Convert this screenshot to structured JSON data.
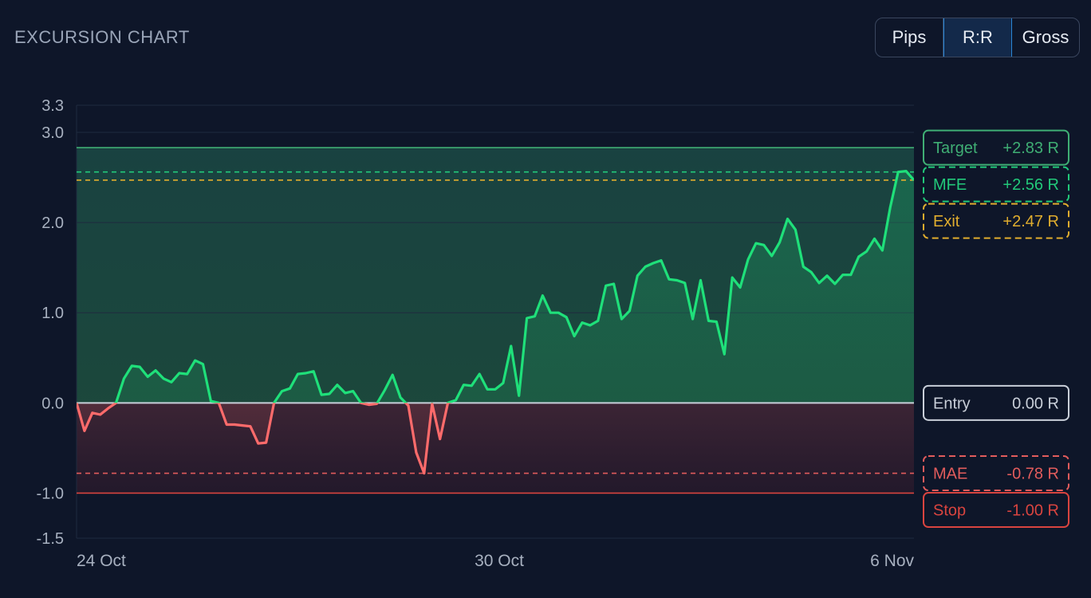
{
  "header": {
    "title": "EXCURSION CHART",
    "toggle": {
      "options": [
        "Pips",
        "R:R",
        "Gross"
      ],
      "selected": "R:R"
    }
  },
  "chart_data": {
    "type": "line",
    "title": "EXCURSION CHART",
    "ylim": [
      -1.5,
      3.3
    ],
    "y_ticks": [
      3.3,
      3.0,
      2.0,
      1.0,
      0.0,
      -1.0,
      -1.5
    ],
    "y_tick_labels": [
      "3.3",
      "3.0",
      "2.0",
      "1.0",
      "0.0",
      "-1.0",
      "-1.5"
    ],
    "x_tick_labels": [
      "24 Oct",
      "30 Oct",
      "6 Nov"
    ],
    "grid": true,
    "series": [
      {
        "values": [
          0.0,
          -0.31,
          -0.11,
          -0.13,
          -0.06,
          0.0,
          0.27,
          0.41,
          0.4,
          0.29,
          0.36,
          0.27,
          0.23,
          0.33,
          0.32,
          0.47,
          0.43,
          0.02,
          0.0,
          -0.24,
          -0.24,
          -0.25,
          -0.26,
          -0.45,
          -0.44,
          0.0,
          0.13,
          0.16,
          0.32,
          0.33,
          0.35,
          0.09,
          0.1,
          0.2,
          0.11,
          0.13,
          0.0,
          -0.02,
          -0.01,
          0.14,
          0.31,
          0.06,
          -0.03,
          -0.55,
          -0.78,
          -0.01,
          -0.4,
          0.0,
          0.03,
          0.2,
          0.19,
          0.32,
          0.15,
          0.15,
          0.22,
          0.63,
          0.08,
          0.94,
          0.96,
          1.19,
          1.0,
          1.0,
          0.95,
          0.74,
          0.89,
          0.86,
          0.91,
          1.3,
          1.32,
          0.93,
          1.02,
          1.41,
          1.51,
          1.55,
          1.58,
          1.37,
          1.36,
          1.33,
          0.93,
          1.36,
          0.91,
          0.9,
          0.54,
          1.39,
          1.28,
          1.59,
          1.77,
          1.75,
          1.63,
          1.78,
          2.04,
          1.92,
          1.51,
          1.45,
          1.33,
          1.41,
          1.32,
          1.42,
          1.42,
          1.62,
          1.68,
          1.82,
          1.69,
          2.17,
          2.56,
          2.57,
          2.47
        ]
      }
    ],
    "levels": [
      {
        "label": "Target",
        "value": 2.83,
        "value_text": "+2.83 R",
        "style": "solid",
        "color": "#3fae74"
      },
      {
        "label": "MFE",
        "value": 2.56,
        "value_text": "+2.56 R",
        "style": "dashed",
        "color": "#22c97a"
      },
      {
        "label": "Exit",
        "value": 2.47,
        "value_text": "+2.47 R",
        "style": "dashed",
        "color": "#e0ad2e"
      },
      {
        "label": "Entry",
        "value": 0.0,
        "value_text": "0.00 R",
        "style": "solid",
        "color": "#c9cfd9"
      },
      {
        "label": "MAE",
        "value": -0.78,
        "value_text": "-0.78 R",
        "style": "dashed",
        "color": "#e25c5c"
      },
      {
        "label": "Stop",
        "value": -1.0,
        "value_text": "-1.00 R",
        "style": "solid",
        "color": "#d9443f"
      }
    ],
    "colors": {
      "positive_line": "#1fe07a",
      "negative_line": "#ff6b6b",
      "grid": "#1f2a3f"
    }
  }
}
